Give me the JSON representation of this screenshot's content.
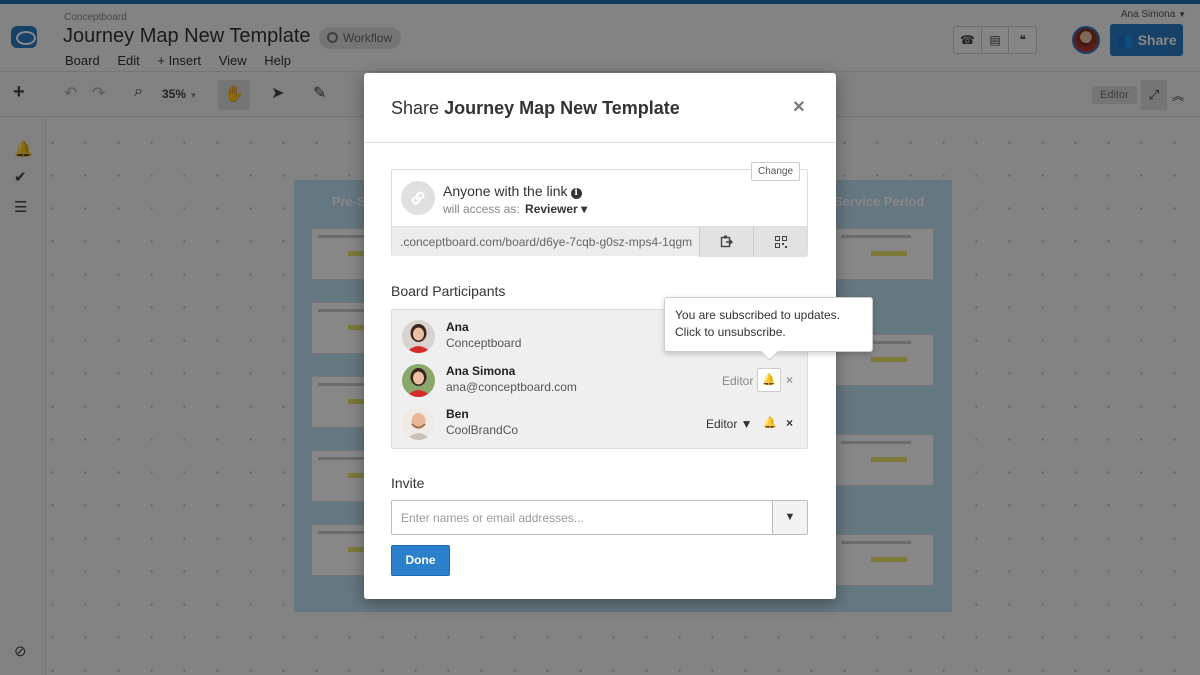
{
  "app": {
    "brand": "Conceptboard",
    "board_title": "Journey Map New Template",
    "workflow_label": "Workflow",
    "menu": [
      "Board",
      "Edit",
      "+ Insert",
      "View",
      "Help"
    ],
    "user_name": "Ana Simona",
    "user_menu_caret": "▼",
    "share_label": "Share",
    "zoom_label": "35%",
    "editor_badge": "Editor",
    "board_header_left": "Pre-S",
    "board_header_right": "Service Period"
  },
  "modal": {
    "title_prefix": "Share",
    "title_name": "Journey Map New Template",
    "close": "×",
    "link": {
      "change_label": "Change",
      "heading": "Anyone with the link",
      "info_glyph": "i",
      "access_prefix": "will access as:",
      "access_role": "Reviewer ▾",
      "url": ".conceptboard.com/board/d6ye-7cqb-g0sz-mps4-1qgm"
    },
    "participants_label": "Board Participants",
    "participants": [
      {
        "name": "Ana",
        "sub": "Conceptboard",
        "role": "",
        "remove": ""
      },
      {
        "name": "Ana Simona",
        "sub": "ana@conceptboard.com",
        "role": "Editor",
        "remove": "×"
      },
      {
        "name": "Ben",
        "sub": "CoolBrandCo",
        "role": "Editor ▼",
        "remove": "×"
      }
    ],
    "tooltip": {
      "line1": "You are subscribed to updates.",
      "line2": "Click to unsubscribe."
    },
    "invite_label": "Invite",
    "invite_placeholder": "Enter names or email addresses...",
    "invite_caret": "▼",
    "done_label": "Done"
  },
  "colors": {
    "primary": "#2b80cc",
    "board_bg": "#bfe0f1",
    "overlay": "rgba(0,0,0,0.47)"
  }
}
